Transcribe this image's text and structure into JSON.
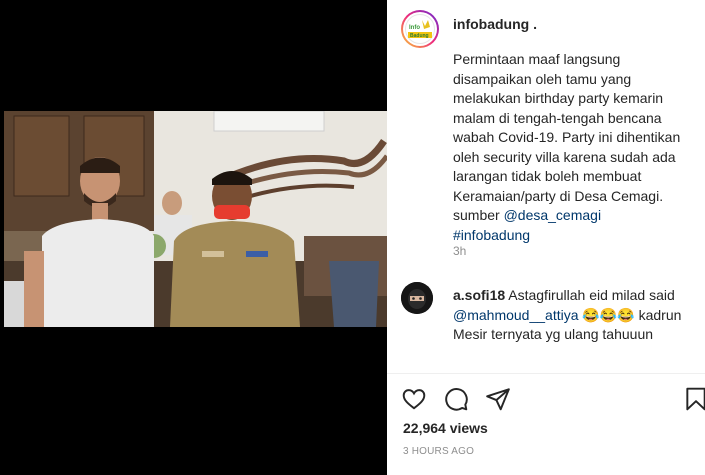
{
  "post": {
    "username": "infobadung .",
    "caption": "Permintaan maaf langsung disampaikan oleh tamu yang melakukan birthday party kemarin malam di tengah-tengah bencana wabah Covid-19. Party ini dihentikan oleh security villa karena sudah ada larangan tidak boleh membuat Keramaian/party di Desa Cemagi. sumber ",
    "caption_mention": "@desa_cemagi",
    "caption_hashtag": "#infobadung",
    "caption_age": "3h",
    "avatar_text_top": "Info",
    "avatar_text_bottom": "Badung",
    "views": "22,964 views",
    "posted": "3 HOURS AGO"
  },
  "comment": {
    "username": "a.sofi18",
    "text_start": " Astagfirullah eid milad said ",
    "mention": "@mahmoud__attiya",
    "emojis": " 😂😂😂",
    "text_end": " kadrun Mesir ternyata yg ulang tahuuun"
  },
  "actions": {
    "like_icon": "heart-icon",
    "comment_icon": "comment-icon",
    "share_icon": "share-icon",
    "save_icon": "bookmark-icon"
  },
  "colors": {
    "link": "#00376b",
    "muted": "#8e8e8e",
    "text": "#262626"
  }
}
